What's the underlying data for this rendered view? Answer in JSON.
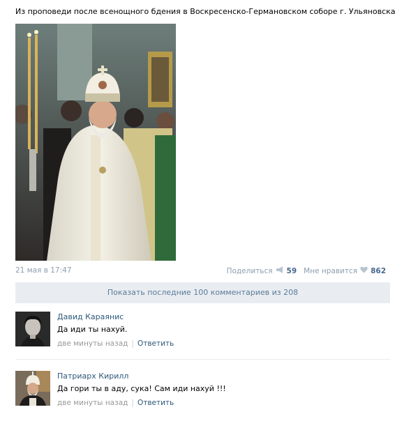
{
  "post": {
    "text": "Из проповеди после всенощного бдения в Воскресенско-Германовском соборе г. Ульяновска",
    "date": "21 мая в 17:47",
    "share_label": "Поделиться",
    "share_count": "59",
    "like_label": "Мне нравится",
    "like_count": "862"
  },
  "comments_bar": {
    "show_label": "Показать последние 100 комментариев из 208"
  },
  "comments": [
    {
      "author": "Давид Караянис",
      "text": "Да иди ты нахуй.",
      "time": "две минуты назад",
      "reply_label": "Ответить"
    },
    {
      "author": "Патриарх Кирилл",
      "text": "Да гори ты в аду, сука! Сам иди нахуй !!!",
      "time": "две минуты назад",
      "reply_label": "Ответить"
    }
  ],
  "colors": {
    "link": "#2b587a",
    "muted": "#8e9eb0",
    "bar_bg": "#e9edf1"
  }
}
